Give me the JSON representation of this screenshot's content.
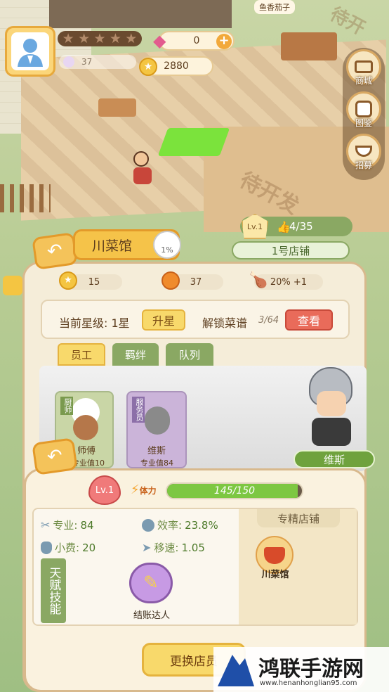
{
  "top": {
    "gems": "0",
    "gold": "2880",
    "rating": "37",
    "stars": [
      "★",
      "★",
      "★",
      "★",
      "★"
    ]
  },
  "scene": {
    "dish_sign": "鱼香茄子",
    "locked_labels": [
      "待开发",
      "待开发",
      "待开"
    ]
  },
  "side_menu": [
    {
      "label": "商城",
      "icon": "shop-icon"
    },
    {
      "label": "图鉴",
      "icon": "catalog-icon"
    },
    {
      "label": "招募",
      "icon": "recruit-icon"
    }
  ],
  "store": {
    "level": "Lv.1",
    "likes": "4/35",
    "name": "1号店铺"
  },
  "restaurant": {
    "title": "川菜馆",
    "percent": "1%",
    "stats": {
      "coins": "15",
      "rating": "37",
      "chicken": "20%  +1"
    },
    "star_label": "当前星级: 1星",
    "upgrade_label": "升星",
    "recipe_label": "解锁菜谱",
    "recipe_count": "3/64",
    "view_label": "查看",
    "tabs": [
      "员工",
      "羁绊",
      "队列"
    ]
  },
  "staff_cards": [
    {
      "role": "厨师",
      "name": "师傅",
      "sub": "专业值10"
    },
    {
      "role": "服务员",
      "name": "维斯",
      "sub": "专业值84"
    }
  ],
  "selected_staff": {
    "name": "维斯",
    "level": "Lv.1",
    "stamina_label": "体力",
    "stamina": "145/150",
    "stamina_fraction": 0.967,
    "stats": [
      {
        "label": "专业:",
        "value": "84",
        "icon": "wrench-icon"
      },
      {
        "label": "效率:",
        "value": "23.8%",
        "icon": "clock-icon"
      },
      {
        "label": "小费:",
        "value": "20",
        "icon": "moneybag-icon"
      },
      {
        "label": "移速:",
        "value": "1.05",
        "icon": "speed-icon"
      }
    ],
    "specialty_title": "专精店铺",
    "specialty_store": "川菜馆",
    "talent_title": "天赋技能",
    "talent_name": "结账达人",
    "change_button": "更换店员"
  },
  "watermark": {
    "text": "鸿联手游网",
    "url": "www.henanhonglian95.com"
  }
}
